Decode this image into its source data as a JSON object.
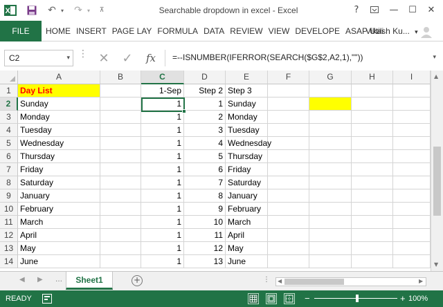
{
  "window": {
    "title": "Searchable dropdown in excel - Excel",
    "help_label": "?",
    "minimize_label": "—",
    "maximize_label": "☐",
    "close_label": "✕"
  },
  "ribbon": {
    "file_label": "FILE",
    "tabs": [
      "HOME",
      "INSERT",
      "PAGE LAY",
      "FORMULA",
      "DATA",
      "REVIEW",
      "VIEW",
      "DEVELOPE",
      "ASAP Utili"
    ],
    "user": "Vikash Ku...",
    "user_dropdown": "▾"
  },
  "formula_bar": {
    "name_box": "C2",
    "formula": "=--ISNUMBER(IFERROR(SEARCH($G$2,A2,1),\"\"))"
  },
  "grid": {
    "columns": [
      "A",
      "B",
      "C",
      "D",
      "E",
      "F",
      "G",
      "H",
      "I"
    ],
    "selected_column": "C",
    "selected_row": 2,
    "rows": [
      {
        "n": "1",
        "A": "Day List",
        "C": "1-Sep",
        "D": "Step 2",
        "E": "Step 3"
      },
      {
        "n": "2",
        "A": "Sunday",
        "C": "1",
        "D": "1",
        "E": "Sunday"
      },
      {
        "n": "3",
        "A": "Monday",
        "C": "1",
        "D": "2",
        "E": "Monday"
      },
      {
        "n": "4",
        "A": "Tuesday",
        "C": "1",
        "D": "3",
        "E": "Tuesday"
      },
      {
        "n": "5",
        "A": "Wednesday",
        "C": "1",
        "D": "4",
        "E": "Wednesday"
      },
      {
        "n": "6",
        "A": "Thursday",
        "C": "1",
        "D": "5",
        "E": "Thursday"
      },
      {
        "n": "7",
        "A": "Friday",
        "C": "1",
        "D": "6",
        "E": "Friday"
      },
      {
        "n": "8",
        "A": "Saturday",
        "C": "1",
        "D": "7",
        "E": "Saturday"
      },
      {
        "n": "9",
        "A": "January",
        "C": "1",
        "D": "8",
        "E": "January"
      },
      {
        "n": "10",
        "A": "February",
        "C": "1",
        "D": "9",
        "E": "February"
      },
      {
        "n": "11",
        "A": "March",
        "C": "1",
        "D": "10",
        "E": "March"
      },
      {
        "n": "12",
        "A": "April",
        "C": "1",
        "D": "11",
        "E": "April"
      },
      {
        "n": "13",
        "A": "May",
        "C": "1",
        "D": "12",
        "E": "May"
      },
      {
        "n": "14",
        "A": "June",
        "C": "1",
        "D": "13",
        "E": "June"
      }
    ]
  },
  "sheets": {
    "tabs": [
      "Sheet1"
    ],
    "add_label": "+"
  },
  "status": {
    "ready": "READY",
    "zoom": "100%",
    "zoom_minus": "−",
    "zoom_plus": "+"
  },
  "colors": {
    "accent": "#217346",
    "highlight": "#ffff00",
    "header_text": "#ff0000"
  }
}
